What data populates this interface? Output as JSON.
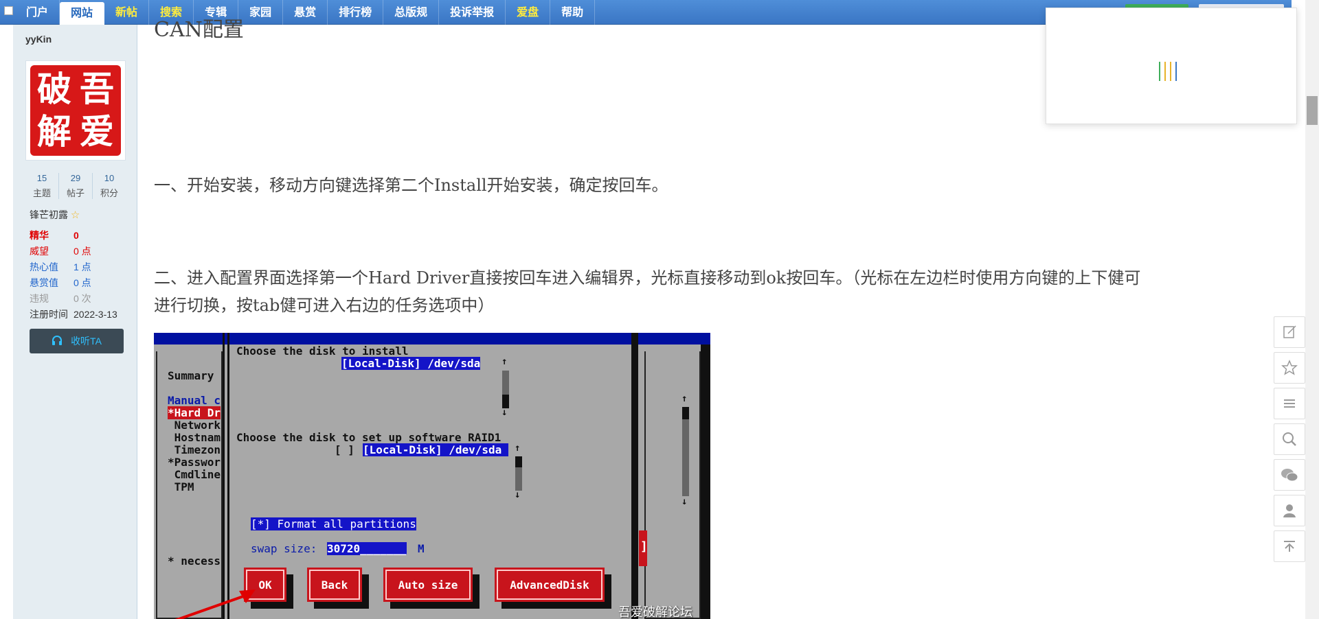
{
  "nav": {
    "items": [
      {
        "label": "门户",
        "active": false,
        "highlight": false
      },
      {
        "label": "网站",
        "active": true,
        "highlight": false
      },
      {
        "label": "新帖",
        "active": false,
        "highlight": true
      },
      {
        "label": "搜索",
        "active": false,
        "highlight": true
      },
      {
        "label": "专辑",
        "active": false,
        "highlight": false
      },
      {
        "label": "家园",
        "active": false,
        "highlight": false
      },
      {
        "label": "悬赏",
        "active": false,
        "highlight": false
      },
      {
        "label": "排行榜",
        "active": false,
        "highlight": false
      },
      {
        "label": "总版规",
        "active": false,
        "highlight": false
      },
      {
        "label": "投诉举报",
        "active": false,
        "highlight": false
      },
      {
        "label": "爱盘",
        "active": false,
        "highlight": true
      },
      {
        "label": "帮助",
        "active": false,
        "highlight": false
      }
    ]
  },
  "profile": {
    "username": "yyKin",
    "avatar_chars": [
      "破",
      "吾",
      "解",
      "爱"
    ],
    "stats": [
      {
        "value": "15",
        "label": "主题"
      },
      {
        "value": "29",
        "label": "帖子"
      },
      {
        "value": "10",
        "label": "积分"
      }
    ],
    "rank": "锋芒初露",
    "info": [
      {
        "key": "精华",
        "value": "0",
        "color": "#e00000",
        "bold": true
      },
      {
        "key": "威望",
        "value": "0 点",
        "color": "#e00000",
        "bold": false
      },
      {
        "key": "热心值",
        "value": "1 点",
        "color": "#2266cc",
        "bold": false
      },
      {
        "key": "悬赏值",
        "value": "0 点",
        "color": "#2266cc",
        "bold": false
      },
      {
        "key": "违规",
        "value": "0 次",
        "color": "#999999",
        "bold": false
      },
      {
        "key": "注册时间",
        "value": "2022-3-13",
        "color": "#333333",
        "bold": false
      }
    ],
    "listen_button": "收听TA"
  },
  "post": {
    "heading_partial": "CAN配置",
    "step1": "一、开始安装，移动方向键选择第二个Install开始安装，确定按回车。",
    "step2_line1": "二、进入配置界面选择第一个Hard Driver直接按回车进入编辑界，光标直接移动到ok按回车。（光标在左边栏时使用方向键的上下健可",
    "step2_line2": "进行切换，按tab健可进入右边的任务选项中）"
  },
  "screenshot": {
    "left_menu": {
      "summary": "Summary",
      "manual": "Manual c",
      "hard": "*Hard Dr",
      "network": " Network",
      "hostname": " Hostnam",
      "timezone": " Timezon",
      "password": "*Passwor",
      "cmdline": " Cmdline",
      "tpm": " TPM",
      "necess": "* necess"
    },
    "choose_install": "Choose the disk to install",
    "disk_install": "[Local-Disk] /dev/sda",
    "choose_raid": "Choose the disk to set up software RAID1",
    "raid_check": "[ ]",
    "disk_raid": "[Local-Disk] /dev/sda ",
    "format_all": "[*] Format all partitions",
    "swap_label": "swap size:",
    "swap_value": "30720_______",
    "swap_unit": "M",
    "buttons": {
      "ok": "OK",
      "back": "Back",
      "auto": "Auto size",
      "advanced": "AdvancedDisk"
    },
    "watermark": "吾爱破解论坛"
  },
  "side_tools": [
    "edit-icon",
    "star-icon",
    "list-icon",
    "search-icon",
    "wechat-icon",
    "user-icon",
    "back-to-top-icon"
  ],
  "colors": {
    "nav_blue": "#3a76c4",
    "sidebar_bg": "#e5edf2",
    "tui_red": "#c8141c",
    "tui_blue": "#1414c8",
    "tui_gray": "#a8a8a8"
  }
}
